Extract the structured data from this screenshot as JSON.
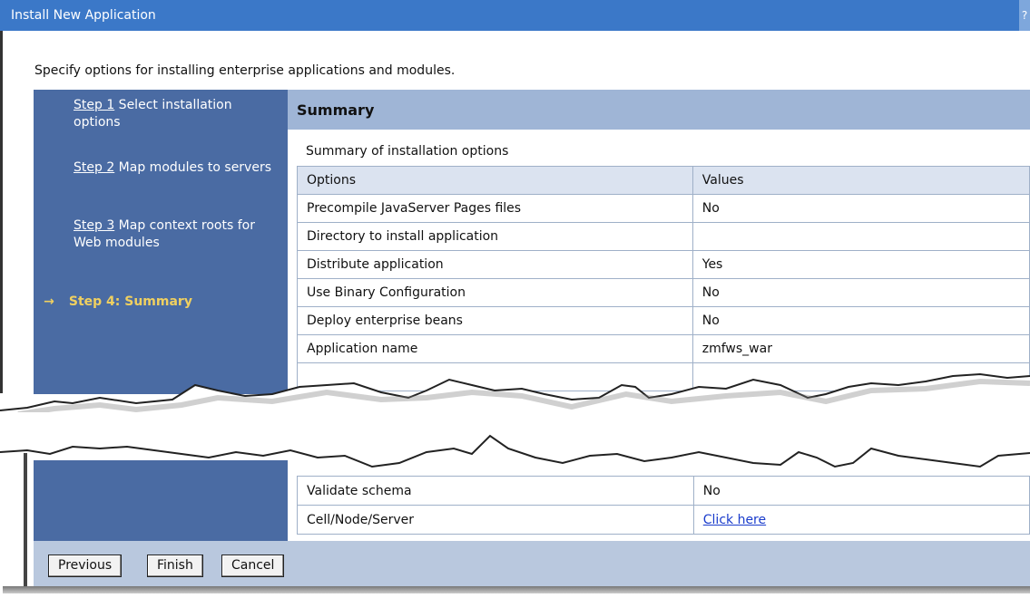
{
  "window": {
    "title": "Install New Application",
    "help_glyph": "?"
  },
  "intro_text": "Specify options for installing enterprise applications and modules.",
  "nav": {
    "steps": [
      {
        "link": "Step 1",
        "rest": " Select installation options"
      },
      {
        "link": "Step 2",
        "rest": " Map modules to servers"
      },
      {
        "link": "Step 3",
        "rest": " Map context roots for Web modules"
      }
    ],
    "current_arrow": "→",
    "current": "Step 4: Summary"
  },
  "summary": {
    "heading": "Summary",
    "subheading": "Summary of installation options",
    "columns": [
      "Options",
      "Values"
    ],
    "rows": [
      [
        "Precompile JavaServer Pages files",
        "No"
      ],
      [
        "Directory to install application",
        ""
      ],
      [
        "Distribute application",
        "Yes"
      ],
      [
        "Use Binary Configuration",
        "No"
      ],
      [
        "Deploy enterprise beans",
        "No"
      ],
      [
        "Application name",
        "zmfws_war"
      ]
    ],
    "rows_bottom": [
      [
        "Validate schema",
        "No"
      ],
      [
        "Cell/Node/Server",
        "Click here"
      ]
    ]
  },
  "buttons": {
    "previous": "Previous",
    "finish": "Finish",
    "cancel": "Cancel"
  },
  "colors": {
    "titlebar": "#3b78c8",
    "nav": "#4a6ba3",
    "header": "#9fb5d6",
    "footer": "#b9c8de",
    "current_step": "#f0d060"
  }
}
